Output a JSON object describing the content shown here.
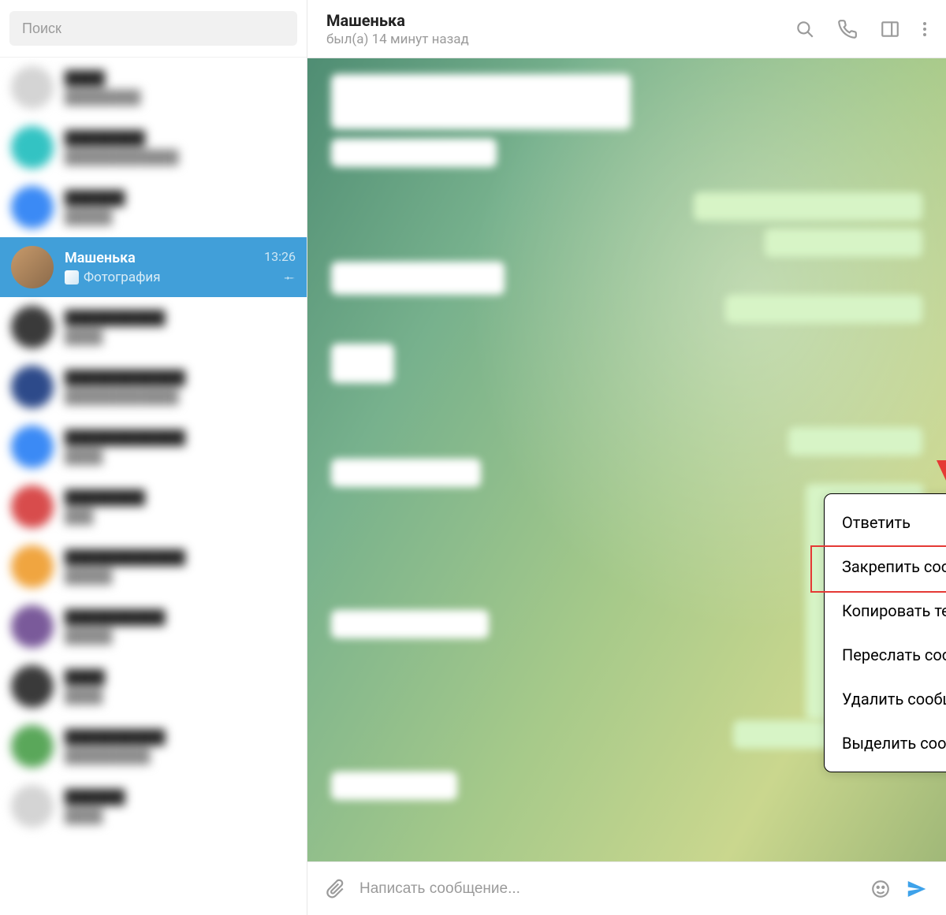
{
  "sidebar": {
    "search_placeholder": "Поиск",
    "active_chat": {
      "name": "Машенька",
      "subtitle": "Фотография",
      "time": "13:26"
    }
  },
  "header": {
    "name": "Машенька",
    "status": "был(а) 14 минут назад"
  },
  "context_menu": {
    "items": [
      "Ответить",
      "Закрепить сообщение",
      "Копировать текст",
      "Переслать сообщение",
      "Удалить сообщение",
      "Выделить сообщение"
    ],
    "highlighted_index": 1
  },
  "composer": {
    "placeholder": "Написать сообщение..."
  },
  "colors": {
    "accent": "#419fd9",
    "send": "#3ea2ea",
    "highlight": "#e53935"
  }
}
